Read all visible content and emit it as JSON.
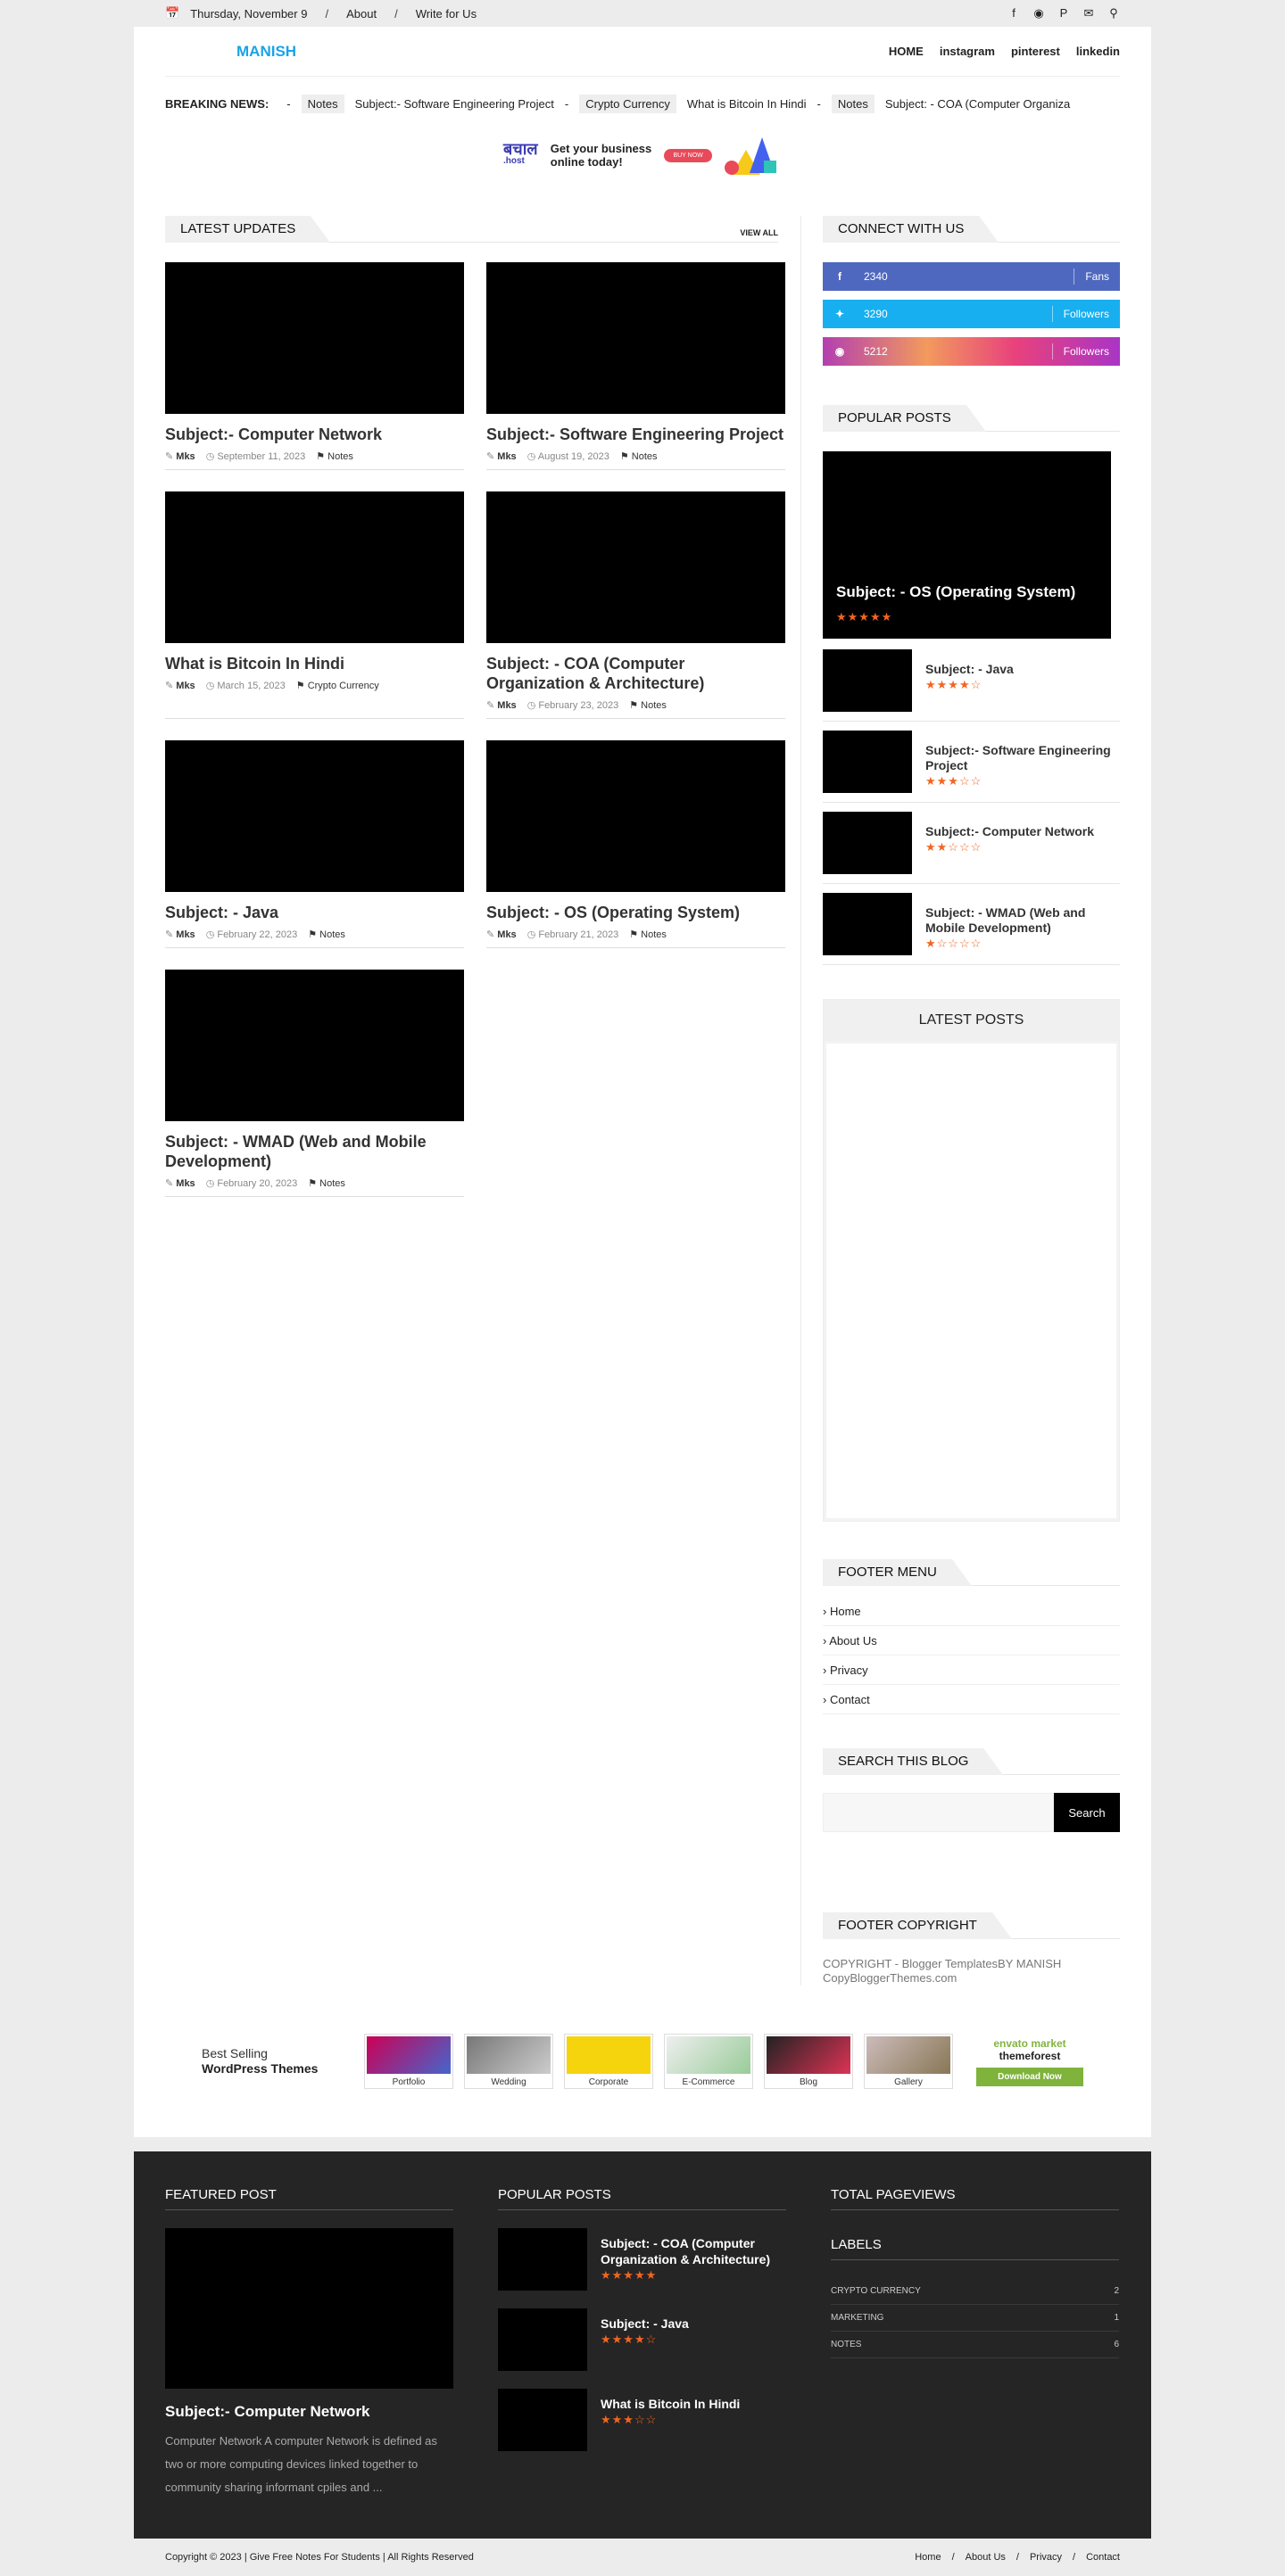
{
  "topbar": {
    "date": "Thursday, November 9",
    "links": [
      "About",
      "Write for Us"
    ],
    "icons": [
      "facebook-icon",
      "instagram-icon",
      "pinterest-icon",
      "mail-icon",
      "search-icon"
    ]
  },
  "header": {
    "logo": "MANISH",
    "nav": [
      "HOME",
      "instagram",
      "pinterest",
      "linkedin"
    ]
  },
  "breaking": {
    "label": "BREAKING NEWS:",
    "items": [
      {
        "tag": "Notes",
        "title": "Subject:- Software Engineering Project"
      },
      {
        "tag": "Crypto Currency",
        "title": "What is Bitcoin In Hindi"
      },
      {
        "tag": "Notes",
        "title": "Subject: - COA (Computer Organiza"
      }
    ]
  },
  "ad": {
    "brand": "बचाल",
    "brand_sub": ".host",
    "text_line1": "Get your business",
    "text_line2": "online today!",
    "button": "BUY NOW"
  },
  "latest": {
    "title": "LATEST UPDATES",
    "view_all": "VIEW ALL",
    "posts": [
      {
        "title": "Subject:- Computer Network",
        "author": "Mks",
        "date": "September 11, 2023",
        "label": "Notes"
      },
      {
        "title": "Subject:- Software Engineering Project",
        "author": "Mks",
        "date": "August 19, 2023",
        "label": "Notes"
      },
      {
        "title": "What is Bitcoin In Hindi",
        "author": "Mks",
        "date": "March 15, 2023",
        "label": "Crypto Currency"
      },
      {
        "title": "Subject: - COA (Computer Organization & Architecture)",
        "author": "Mks",
        "date": "February 23, 2023",
        "label": "Notes"
      },
      {
        "title": "Subject: - Java",
        "author": "Mks",
        "date": "February 22, 2023",
        "label": "Notes"
      },
      {
        "title": "Subject: - OS (Operating System)",
        "author": "Mks",
        "date": "February 21, 2023",
        "label": "Notes"
      },
      {
        "title": "Subject: - WMAD (Web and Mobile Development)",
        "author": "Mks",
        "date": "February 20, 2023",
        "label": "Notes"
      }
    ]
  },
  "connect": {
    "title": "CONNECT WITH US",
    "rows": [
      {
        "icon": "f",
        "count": "2340",
        "label": "Fans",
        "color": "#4f68bf"
      },
      {
        "icon": "t",
        "count": "3290",
        "label": "Followers",
        "color": "#17aff0"
      },
      {
        "icon": "ig",
        "count": "5212",
        "label": "Followers",
        "color": "#d9418a"
      }
    ]
  },
  "popular": {
    "title": "POPULAR POSTS",
    "big": {
      "title": "Subject: - OS (Operating System)",
      "rating": 5
    },
    "items": [
      {
        "title": "Subject: - Java",
        "rating": 4
      },
      {
        "title": "Subject:- Software Engineering Project",
        "rating": 3
      },
      {
        "title": "Subject:- Computer Network",
        "rating": 2
      },
      {
        "title": "Subject: - WMAD (Web and Mobile Development)",
        "rating": 1
      }
    ]
  },
  "latest_posts": {
    "title": "LATEST POSTS"
  },
  "footer_menu": {
    "title": "FOOTER MENU",
    "items": [
      "Home",
      "About Us",
      "Privacy",
      "Contact"
    ]
  },
  "search_blog": {
    "title": "SEARCH THIS BLOG",
    "button": "Search"
  },
  "footer_copyright": {
    "title": "FOOTER COPYRIGHT",
    "prefix": "COPYRIGHT - ",
    "link1": "Blogger Templates",
    "by": "BY MANISH",
    "link2": "CopyBloggerThemes.com"
  },
  "wp_banner": {
    "line1": "Best Selling",
    "line2": "WordPress Themes",
    "themes": [
      "Portfolio",
      "Wedding",
      "Corporate",
      "E-Commerce",
      "Blog",
      "Gallery"
    ],
    "envato": "envato market",
    "themeforest": "themeforest",
    "download": "Download Now"
  },
  "footer": {
    "featured": {
      "title": "FEATURED POST",
      "post_title": "Subject:- Computer Network",
      "excerpt": "Computer Network A computer Network is defined as two or more computing devices linked together to community sharing informant cpiles and ..."
    },
    "popular": {
      "title": "POPULAR POSTS",
      "items": [
        {
          "title": "Subject: - COA (Computer Organization & Architecture)",
          "rating": 5
        },
        {
          "title": "Subject: - Java",
          "rating": 4
        },
        {
          "title": "What is Bitcoin In Hindi",
          "rating": 3
        }
      ]
    },
    "pageviews": {
      "title": "TOTAL PAGEVIEWS"
    },
    "labels": {
      "title": "LABELS",
      "items": [
        {
          "name": "CRYPTO CURRENCY",
          "count": "2"
        },
        {
          "name": "MARKETING",
          "count": "1"
        },
        {
          "name": "NOTES",
          "count": "6"
        }
      ]
    }
  },
  "bottom": {
    "copyright": "Copyright © 2023 | Give Free Notes For Students | All Rights Reserved",
    "links": [
      "Home",
      "About Us",
      "Privacy",
      "Contact"
    ]
  }
}
